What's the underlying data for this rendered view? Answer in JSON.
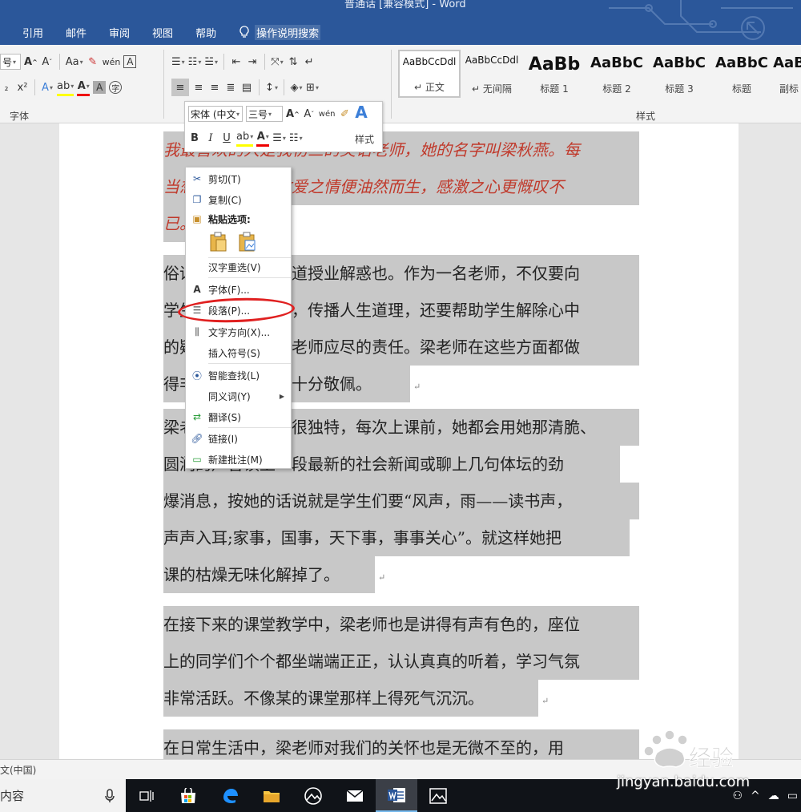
{
  "window": {
    "title": "普通话 [兼容模式] - Word"
  },
  "tabs": [
    "引用",
    "邮件",
    "审阅",
    "视图",
    "帮助"
  ],
  "tell_me": "操作说明搜索",
  "ribbon": {
    "font_group_label": "字体",
    "styles_group_label": "样式",
    "font_size_partial": "号",
    "styles": [
      {
        "sample": "AaBbCcDdl",
        "name": "正文"
      },
      {
        "sample": "AaBbCcDdl",
        "name": "无间隔"
      },
      {
        "sample": "AaBb",
        "name": "标题 1"
      },
      {
        "sample": "AaBbC",
        "name": "标题 2"
      },
      {
        "sample": "AaBbC",
        "name": "标题 3"
      },
      {
        "sample": "AaBbC",
        "name": "标题"
      },
      {
        "sample": "AaB",
        "name": "副标"
      }
    ]
  },
  "mini_toolbar": {
    "font": "宋体 (中文",
    "size": "三号",
    "styles_label": "样式"
  },
  "context_menu": {
    "items": [
      {
        "label": "剪切(T)",
        "icon": "scissors-icon"
      },
      {
        "label": "复制(C)",
        "icon": "copy-icon"
      },
      {
        "label": "粘贴选项:",
        "icon": "clipboard-icon"
      },
      {
        "label": "汉字重选(V)",
        "icon": ""
      },
      {
        "label": "字体(F)...",
        "icon": "font-icon"
      },
      {
        "label": "段落(P)...",
        "icon": "paragraph-icon"
      },
      {
        "label": "文字方向(X)...",
        "icon": "text-direction-icon"
      },
      {
        "label": "插入符号(S)",
        "icon": ""
      },
      {
        "label": "智能查找(L)",
        "icon": "smart-lookup-icon"
      },
      {
        "label": "同义词(Y)",
        "icon": ""
      },
      {
        "label": "翻译(S)",
        "icon": "translate-icon"
      },
      {
        "label": "链接(I)",
        "icon": "link-icon"
      },
      {
        "label": "新建批注(M)",
        "icon": "comment-icon"
      }
    ]
  },
  "document": {
    "red_paragraph": [
      "我最喜欢的人是我初三的英语老师，她的名字叫梁秋燕。每",
      "当想起她，我的敬爱之情便油然而生，感激之心更慨叹不",
      "已。"
    ],
    "paragraphs": [
      [
        "俗话说：师者，传道授业解惑也。作为一名老师，不仅要向",
        "学生传授文化知识，传播人生道理，还要帮助学生解除心中",
        "的疑惑，这些都是老师应尽的责任。梁老师在这些方面都做",
        "得非常好，这让我十分敬佩。"
      ],
      [
        "梁老师的上课方式很独特，每次上课前，她都会用她那清脆、",
        "圆润的声音读上一段最新的社会新闻或聊上几句体坛的劲",
        "爆消息，按她的话说就是学生们要“风声，雨——读书声，",
        "声声入耳;家事，国事，天下事，事事关心”。就这样她把",
        "课的枯燥无味化解掉了。"
      ],
      [
        "在接下来的课堂教学中，梁老师也是讲得有声有色的，座位",
        "上的同学们个个都坐端端正正，认认真真的听着，学习气氛",
        "非常活跃。不像某的课堂那样上得死气沉沉。"
      ],
      [
        "在日常生活中，梁老师对我们的关怀也是无微不至的，用"
      ]
    ]
  },
  "status_bar": {
    "language": "文(中国)"
  },
  "taskbar": {
    "search_text": "内容"
  },
  "watermark": {
    "text": "jingyan.baidu.com",
    "brand": "Baidu 经验"
  },
  "colors": {
    "word_blue": "#2b579a",
    "selection": "#c8c8c8",
    "red_text": "#c0392b",
    "highlight_ellipse": "#e02020"
  }
}
